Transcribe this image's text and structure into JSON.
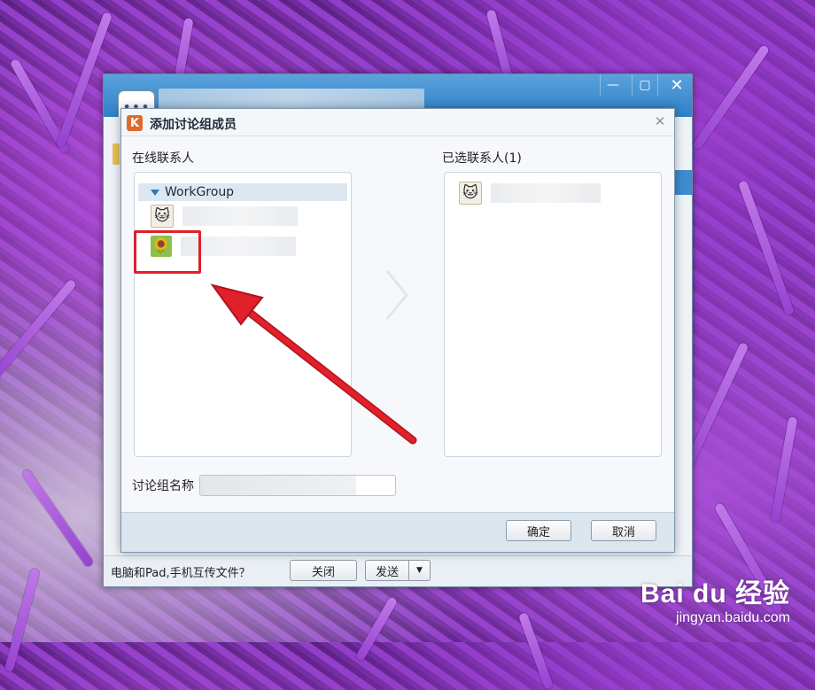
{
  "main_window": {
    "bottom_text": "电脑和Pad,手机互传文件？",
    "close_label": "关闭",
    "send_label": "发送",
    "send_arrow": "▼",
    "minimize_glyph": "—",
    "maximize_glyph": "▢",
    "close_glyph": "✕",
    "app_icon_glyph": "•••"
  },
  "dialog": {
    "logo_glyph": "K",
    "title": "添加讨论组成员",
    "close_glyph": "✕",
    "left_label": "在线联系人",
    "right_label": "已选联系人(1)",
    "group_name": "WorkGroup",
    "contacts": [
      {
        "avatar_icon": "lucky-cat-avatar-icon",
        "avatar_glyph": "🐱"
      },
      {
        "avatar_icon": "sunflower-avatar-icon",
        "avatar_glyph": "🌻"
      }
    ],
    "selected": [
      {
        "avatar_icon": "lucky-cat-avatar-icon",
        "avatar_glyph": "🐱"
      }
    ],
    "name_label": "讨论组名称",
    "name_value": "",
    "ok_label": "确定",
    "cancel_label": "取消"
  },
  "annotation": {
    "highlight_color": "#e0202a",
    "arrow_color": "#e0202a"
  },
  "watermark": {
    "logo": "Bai du 经验",
    "url": "jingyan.baidu.com"
  }
}
